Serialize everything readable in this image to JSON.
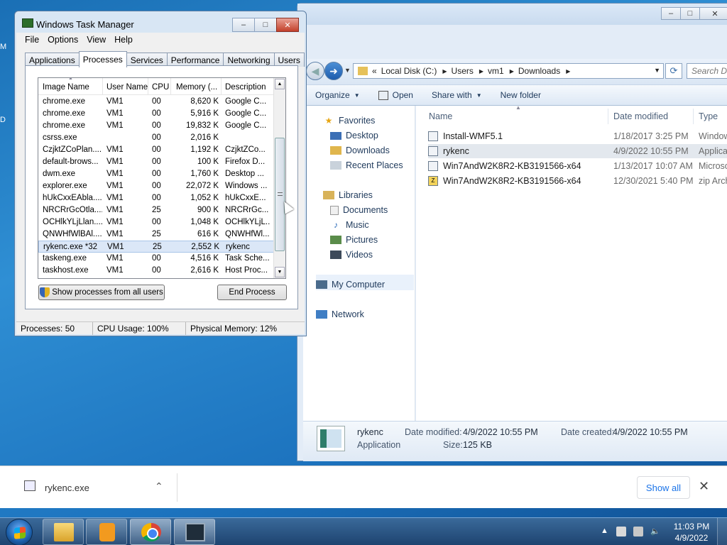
{
  "desktop": {
    "stub_top": "M",
    "stub_mid": "D"
  },
  "explorer": {
    "address": [
      "«",
      "Local Disk (C:)",
      "Users",
      "vm1",
      "Downloads"
    ],
    "search_placeholder": "Search Downloads",
    "toolbar": {
      "organize": "Organize",
      "open": "Open",
      "share_with": "Share with",
      "new_folder": "New folder"
    },
    "nav": {
      "favorites": "Favorites",
      "desktop": "Desktop",
      "downloads": "Downloads",
      "recent_places": "Recent Places",
      "libraries": "Libraries",
      "documents": "Documents",
      "music": "Music",
      "pictures": "Pictures",
      "videos": "Videos",
      "my_computer": "My Computer",
      "network": "Network"
    },
    "columns": {
      "name": "Name",
      "date_modified": "Date modified",
      "type": "Type"
    },
    "files": [
      {
        "name": "Install-WMF5.1",
        "date": "1/18/2017 3:25 PM",
        "type": "Windows"
      },
      {
        "name": "rykenc",
        "date": "4/9/2022 10:55 PM",
        "type": "Application"
      },
      {
        "name": "Win7AndW2K8R2-KB3191566-x64",
        "date": "1/13/2017 10:07 AM",
        "type": "Microsoft"
      },
      {
        "name": "Win7AndW2K8R2-KB3191566-x64",
        "date": "12/30/2021 5:40 PM",
        "type": "zip Archive"
      }
    ],
    "details": {
      "name": "rykenc",
      "type": "Application",
      "date_modified_label": "Date modified:",
      "date_modified": "4/9/2022 10:55 PM",
      "date_created_label": "Date created:",
      "date_created": "4/9/2022 10:55 PM",
      "size_label": "Size:",
      "size": "125 KB"
    }
  },
  "taskmgr": {
    "title": "Windows Task Manager",
    "menu": [
      "File",
      "Options",
      "View",
      "Help"
    ],
    "tabs": [
      "Applications",
      "Processes",
      "Services",
      "Performance",
      "Networking",
      "Users"
    ],
    "columns": [
      "Image Name",
      "User Name",
      "CPU",
      "Memory (...",
      "Description"
    ],
    "processes": [
      {
        "image": "chrome.exe",
        "user": "VM1",
        "cpu": "00",
        "mem": "8,620 K",
        "desc": "Google C..."
      },
      {
        "image": "chrome.exe",
        "user": "VM1",
        "cpu": "00",
        "mem": "5,916 K",
        "desc": "Google C..."
      },
      {
        "image": "chrome.exe",
        "user": "VM1",
        "cpu": "00",
        "mem": "19,832 K",
        "desc": "Google C..."
      },
      {
        "image": "csrss.exe",
        "user": "",
        "cpu": "00",
        "mem": "2,016 K",
        "desc": ""
      },
      {
        "image": "CzjktZCoPlan....",
        "user": "VM1",
        "cpu": "00",
        "mem": "1,192 K",
        "desc": "CzjktZCo..."
      },
      {
        "image": "default-brows...",
        "user": "VM1",
        "cpu": "00",
        "mem": "100 K",
        "desc": "Firefox D..."
      },
      {
        "image": "dwm.exe",
        "user": "VM1",
        "cpu": "00",
        "mem": "1,760 K",
        "desc": "Desktop ..."
      },
      {
        "image": "explorer.exe",
        "user": "VM1",
        "cpu": "00",
        "mem": "22,072 K",
        "desc": "Windows ..."
      },
      {
        "image": "hUkCxxEAbla....",
        "user": "VM1",
        "cpu": "00",
        "mem": "1,052 K",
        "desc": "hUkCxxE..."
      },
      {
        "image": "NRCRrGcOtla....",
        "user": "VM1",
        "cpu": "25",
        "mem": "900 K",
        "desc": "NRCRrGc..."
      },
      {
        "image": "OCHlkYLjLlan....",
        "user": "VM1",
        "cpu": "00",
        "mem": "1,048 K",
        "desc": "OCHlkYLjL..."
      },
      {
        "image": "QNWHfWlBAl....",
        "user": "VM1",
        "cpu": "25",
        "mem": "616 K",
        "desc": "QNWHfWl..."
      },
      {
        "image": "rykenc.exe *32",
        "user": "VM1",
        "cpu": "25",
        "mem": "2,552 K",
        "desc": "rykenc"
      },
      {
        "image": "taskeng.exe",
        "user": "VM1",
        "cpu": "00",
        "mem": "4,516 K",
        "desc": "Task Sche..."
      },
      {
        "image": "taskhost.exe",
        "user": "VM1",
        "cpu": "00",
        "mem": "2,616 K",
        "desc": "Host Proc..."
      }
    ],
    "show_all_button": "Show processes from all users",
    "end_process_button": "End Process",
    "status": {
      "processes": "Processes: 50",
      "cpu": "CPU Usage: 100%",
      "memory": "Physical Memory: 12%"
    }
  },
  "download_bar": {
    "file": "rykenc.exe",
    "show_all": "Show all"
  },
  "taskbar": {
    "time": "11:03 PM",
    "date": "4/9/2022"
  }
}
